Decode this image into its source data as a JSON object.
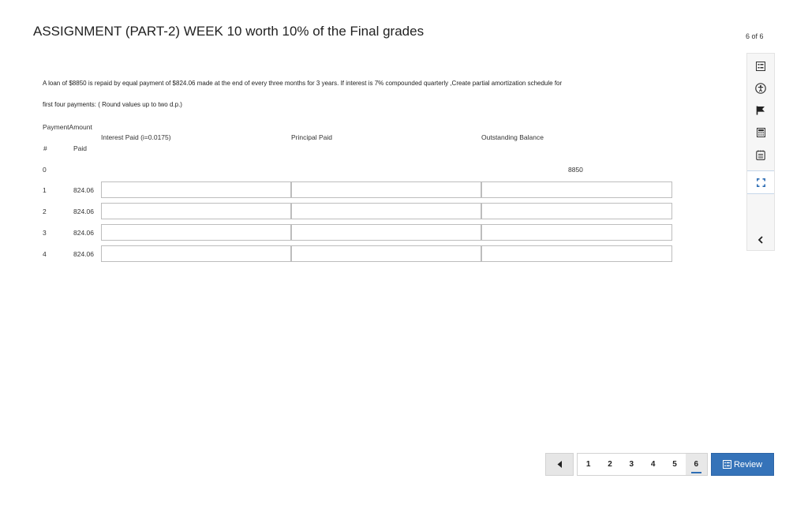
{
  "header": {
    "title": "ASSIGNMENT (PART-2) WEEK 10 worth 10% of the Final grades",
    "page_indicator": "6 of 6"
  },
  "question": {
    "line1": "A loan of $8850 is repaid by equal payment of $824.06 made at the end of every three months for 3 years. If interest is 7% compounded quarterly ,Create partial amortization schedule for",
    "line2": "first four payments: ( Round values up to two d.p.)"
  },
  "table": {
    "header_payment_amount": "PaymentAmount",
    "header_hash": "#",
    "header_paid": "Paid",
    "header_interest": "Interest Paid (i=0.0175)",
    "header_principal": "Principal Paid",
    "header_balance": "Outstanding Balance",
    "row0": {
      "num": "0",
      "balance": "8850"
    },
    "rows": [
      {
        "num": "1",
        "paid": "824.06",
        "interest": "",
        "principal": "",
        "balance": ""
      },
      {
        "num": "2",
        "paid": "824.06",
        "interest": "",
        "principal": "",
        "balance": ""
      },
      {
        "num": "3",
        "paid": "824.06",
        "interest": "",
        "principal": "",
        "balance": ""
      },
      {
        "num": "4",
        "paid": "824.06",
        "interest": "",
        "principal": "",
        "balance": ""
      }
    ]
  },
  "toolstrip": {
    "tools": [
      "list-icon",
      "accessibility-icon",
      "flag-icon",
      "calculator-icon",
      "notes-icon",
      "expand-icon",
      "collapse-chevron-icon"
    ]
  },
  "pagination": {
    "pages": [
      "1",
      "2",
      "3",
      "4",
      "5",
      "6"
    ],
    "current": "6",
    "review_label": "Review"
  },
  "colors": {
    "accent": "#3573b9",
    "input_border": "#bdbdbd"
  }
}
